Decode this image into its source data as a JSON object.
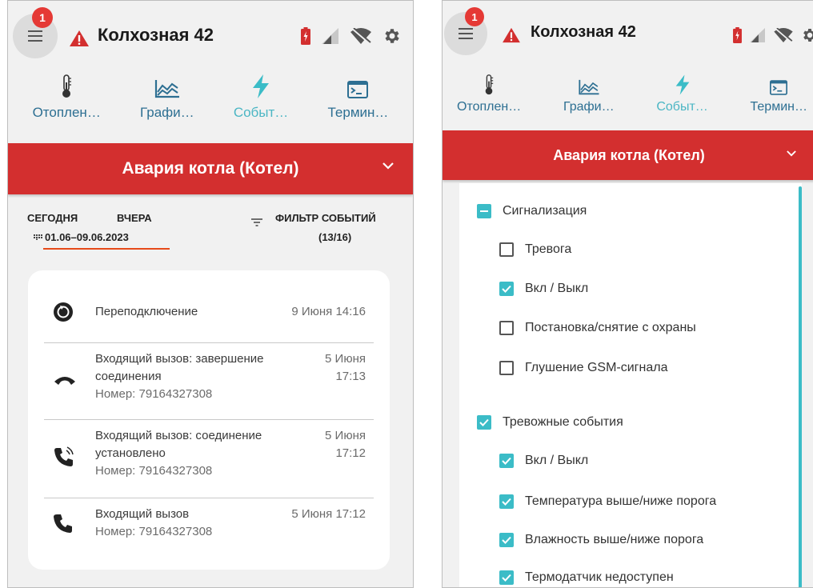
{
  "app": {
    "notification_count": "1",
    "location_title": "Колхозная 42",
    "colors": {
      "accent": "#3bbcc7",
      "alarm": "#d32f2f",
      "tab_text": "#2d6f92",
      "badge": "#e53935"
    }
  },
  "tabs_full": [
    {
      "label": "Отоплен…",
      "icon": "thermometer-icon"
    },
    {
      "label": "Графи…",
      "icon": "chart-icon"
    },
    {
      "label": "Событ…",
      "icon": "lightning-icon",
      "active": true
    },
    {
      "label": "Термин…",
      "icon": "terminal-icon"
    }
  ],
  "tabs_compact": [
    {
      "label": "Отоплен…"
    },
    {
      "label": "Графи…"
    },
    {
      "label": "Событ…"
    },
    {
      "label": "Термин…"
    }
  ],
  "alarm": {
    "label": "Авария котла (Котел)"
  },
  "filters": {
    "today": "СЕГОДНЯ",
    "yesterday": "ВЧЕРА",
    "range": "01.06–09.06.2023",
    "filter_label": "ФИЛЬТР СОБЫТИЙ",
    "filter_count": "(13/16)"
  },
  "events": [
    {
      "icon": "reconnect-icon",
      "title": "Переподключение",
      "title2": "",
      "number": "",
      "time": "9 Июня 14:16"
    },
    {
      "icon": "call-end-icon",
      "title": "Входящий вызов: завершение",
      "title2": "соединения",
      "number": "Номер: 79164327308",
      "time": "5 Июня",
      "time2": "17:13"
    },
    {
      "icon": "call-connected-icon",
      "title": "Входящий вызов: соединение",
      "title2": "установлено",
      "number": "Номер: 79164327308",
      "time": "5 Июня",
      "time2": "17:12"
    },
    {
      "icon": "phone-icon",
      "title": "Входящий вызов",
      "title2": "",
      "number": "Номер: 79164327308",
      "time": "5 Июня 17:12"
    }
  ],
  "event_filter_options": [
    {
      "label": "Сигнализация",
      "state": "indeterminate",
      "level": 0
    },
    {
      "label": "Тревога",
      "state": "unchecked",
      "level": 1
    },
    {
      "label": "Вкл / Выкл",
      "state": "checked",
      "level": 1
    },
    {
      "label": "Постановка/снятие с охраны",
      "state": "unchecked",
      "level": 1
    },
    {
      "label": "Глушение GSM-сигнала",
      "state": "unchecked",
      "level": 1
    },
    {
      "label": "Тревожные события",
      "state": "checked",
      "level": 0
    },
    {
      "label": "Вкл / Выкл",
      "state": "checked",
      "level": 1
    },
    {
      "label": "Температура выше/ниже порога",
      "state": "checked",
      "level": 1
    },
    {
      "label": "Влажность выше/ниже порога",
      "state": "checked",
      "level": 1
    },
    {
      "label": "Термодатчик недоступен",
      "state": "checked",
      "level": 1
    }
  ]
}
